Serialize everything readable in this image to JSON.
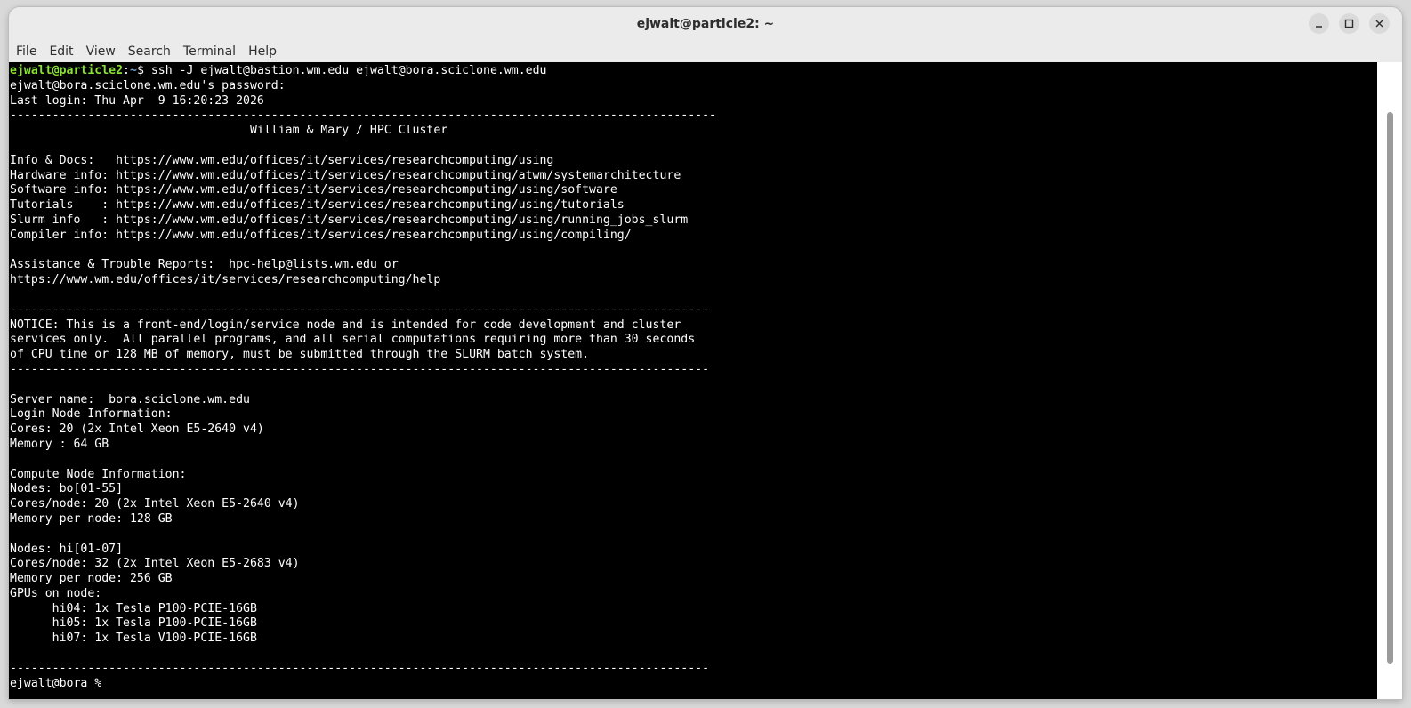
{
  "window": {
    "title": "ejwalt@particle2: ~"
  },
  "menu": [
    "File",
    "Edit",
    "View",
    "Search",
    "Terminal",
    "Help"
  ],
  "prompt": {
    "user_host": "ejwalt@particle2",
    "separator": ":",
    "path": "~",
    "symbol": "$",
    "command": " ssh -J ejwalt@bastion.wm.edu ejwalt@bora.sciclone.wm.edu"
  },
  "lines": [
    "ejwalt@bora.sciclone.wm.edu's password:",
    "Last login: Thu Apr  9 16:20:23 2026",
    "----------------------------------------------------------------------------------------------------",
    "                                  William & Mary / HPC Cluster",
    "",
    "Info & Docs:   https://www.wm.edu/offices/it/services/researchcomputing/using",
    "Hardware info: https://www.wm.edu/offices/it/services/researchcomputing/atwm/systemarchitecture",
    "Software info: https://www.wm.edu/offices/it/services/researchcomputing/using/software",
    "Tutorials    : https://www.wm.edu/offices/it/services/researchcomputing/using/tutorials",
    "Slurm info   : https://www.wm.edu/offices/it/services/researchcomputing/using/running_jobs_slurm",
    "Compiler info: https://www.wm.edu/offices/it/services/researchcomputing/using/compiling/",
    "",
    "Assistance & Trouble Reports:  hpc-help@lists.wm.edu or",
    "https://www.wm.edu/offices/it/services/researchcomputing/help",
    "",
    "---------------------------------------------------------------------------------------------------",
    "NOTICE: This is a front-end/login/service node and is intended for code development and cluster",
    "services only.  All parallel programs, and all serial computations requiring more than 30 seconds",
    "of CPU time or 128 MB of memory, must be submitted through the SLURM batch system.",
    "---------------------------------------------------------------------------------------------------",
    "",
    "Server name:  bora.sciclone.wm.edu",
    "Login Node Information:",
    "Cores: 20 (2x Intel Xeon E5-2640 v4)",
    "Memory : 64 GB",
    "",
    "Compute Node Information:",
    "Nodes: bo[01-55]",
    "Cores/node: 20 (2x Intel Xeon E5-2640 v4)",
    "Memory per node: 128 GB",
    "",
    "Nodes: hi[01-07]",
    "Cores/node: 32 (2x Intel Xeon E5-2683 v4)",
    "Memory per node: 256 GB",
    "GPUs on node:",
    "      hi04: 1x Tesla P100-PCIE-16GB",
    "      hi05: 1x Tesla P100-PCIE-16GB",
    "      hi07: 1x Tesla V100-PCIE-16GB",
    "",
    "---------------------------------------------------------------------------------------------------",
    "ejwalt@bora % "
  ]
}
